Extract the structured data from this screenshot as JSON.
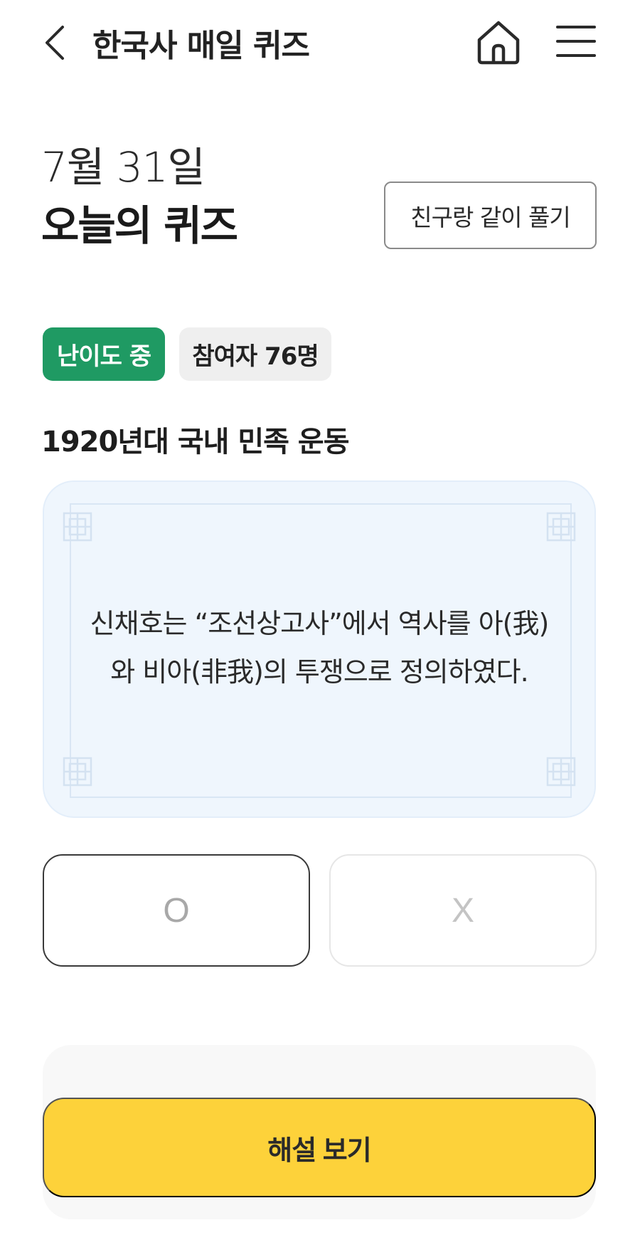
{
  "header": {
    "title": "한국사 매일 퀴즈",
    "back_icon": "chevron-left-icon",
    "home_icon": "home-icon",
    "menu_icon": "hamburger-menu-icon"
  },
  "quiz": {
    "date": "7월 31일",
    "title": "오늘의 퀴즈",
    "friend_button": "친구랑 같이 풀기",
    "difficulty_badge": "난이도 중",
    "participants_badge": "참여자 76명",
    "topic": "1920년대 국내 민족 운동",
    "question_line1": "신채호는 “조선상고사”에서 역사를 아(我)",
    "question_line2": "와 비아(非我)의 투쟁으로 정의하였다.",
    "answer_o": "O",
    "answer_x": "X",
    "explain_button": "해설 보기"
  },
  "colors": {
    "difficulty_badge": "#1f9a63",
    "card_background": "#eff6fd",
    "explain_button": "#fdd23a"
  }
}
